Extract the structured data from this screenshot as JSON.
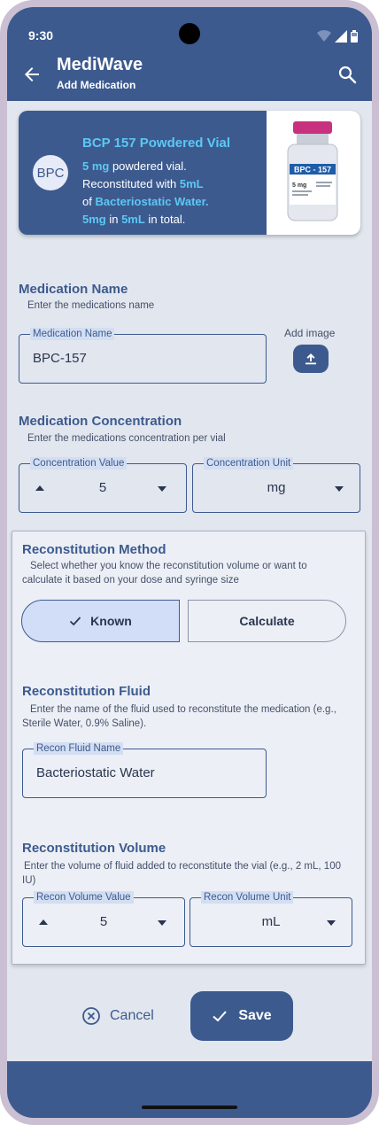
{
  "status_bar": {
    "time": "9:30"
  },
  "app_bar": {
    "title": "MediWave",
    "subtitle": "Add Medication"
  },
  "info_card": {
    "avatar_text": "BPC",
    "title": "BCP 157 Powdered Vial",
    "line1_amount": "5 mg",
    "line1_rest": " powdered vial.",
    "line2_text": "Reconstituted with ",
    "line2_amount": "5mL",
    "line3_prefix": "of ",
    "line3_fluid": "Bacteriostatic Water.",
    "line4_dose": "5mg",
    "line4_mid": " in ",
    "line4_volume": "5mL",
    "line4_end": " in total.",
    "vial_label": "BPC - 157",
    "vial_dose": "5 mg"
  },
  "medication_name": {
    "title": "Medication Name",
    "help": "Enter the medications name",
    "field_label": "Medication Name",
    "value": "BPC-157",
    "add_image_label": "Add image"
  },
  "concentration": {
    "title": "Medication Concentration",
    "help": "Enter the medications concentration per vial",
    "value_label": "Concentration Value",
    "value": "5",
    "unit_label": "Concentration Unit",
    "unit": "mg"
  },
  "recon_method": {
    "title": "Reconstitution Method",
    "help": "Select whether you know the reconstitution volume or want to calculate it based on your dose and syringe size",
    "known_label": "Known",
    "calculate_label": "Calculate",
    "selected": "Known"
  },
  "recon_fluid": {
    "title": "Reconstitution Fluid",
    "help": "Enter the name of the fluid used to reconstitute the medication (e.g., Sterile Water, 0.9% Saline).",
    "field_label": "Recon Fluid Name",
    "value": "Bacteriostatic Water"
  },
  "recon_volume": {
    "title": "Reconstitution Volume",
    "help": "Enter the volume of fluid added to reconstitute the vial (e.g., 2 mL, 100 IU)",
    "value_label": "Recon Volume Value",
    "value": "5",
    "unit_label": "Recon Volume Unit",
    "unit": "mL"
  },
  "actions": {
    "cancel_label": "Cancel",
    "save_label": "Save"
  },
  "colors": {
    "primary": "#3d5a8f",
    "accent": "#5cc8f2",
    "background": "#e2e6ee"
  }
}
